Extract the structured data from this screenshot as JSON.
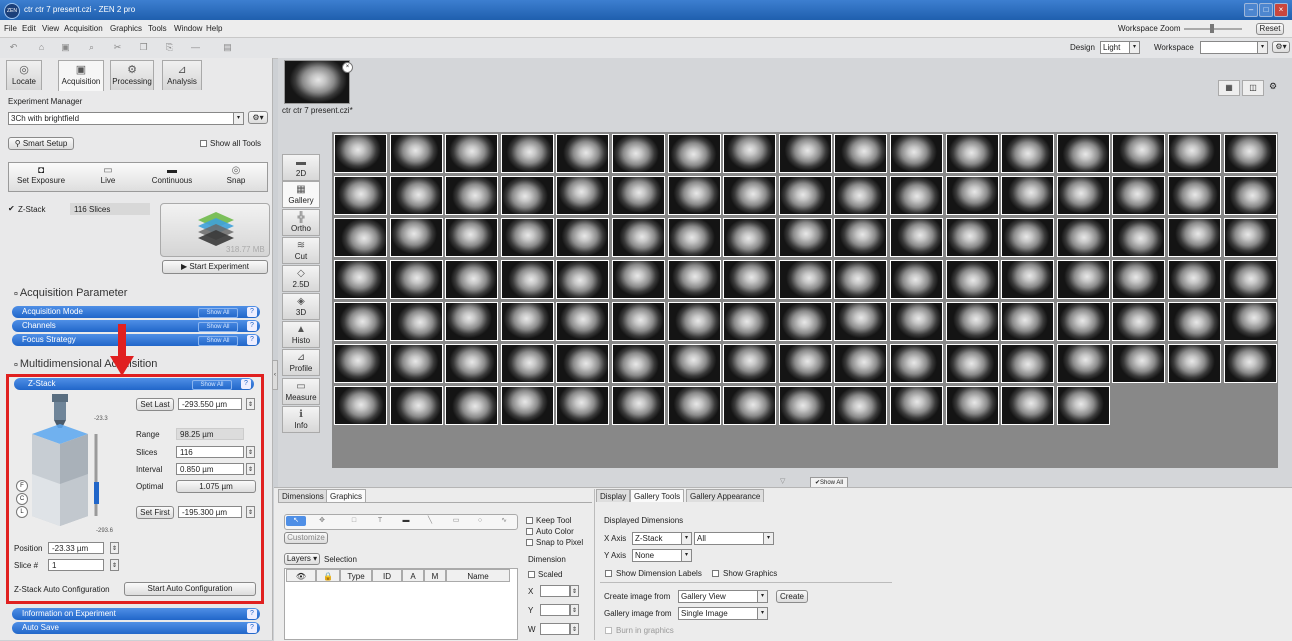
{
  "window": {
    "title": "ctr ctr 7 present.czi - ZEN 2 pro",
    "app_icon": "ZEN"
  },
  "menu": [
    "File",
    "Edit",
    "View",
    "Acquisition",
    "Graphics",
    "Tools",
    "Window",
    "Help"
  ],
  "top_right": {
    "workspace_zoom_label": "Workspace Zoom",
    "reset_label": "Reset",
    "design_label": "Design",
    "design_value": "Light",
    "workspace_label": "Workspace",
    "workspace_value": ""
  },
  "left_tabs": [
    {
      "label": "Locate",
      "icon": "locate-icon"
    },
    {
      "label": "Acquisition",
      "icon": "acquisition-icon"
    },
    {
      "label": "Processing",
      "icon": "processing-icon"
    },
    {
      "label": "Analysis",
      "icon": "analysis-icon"
    }
  ],
  "experiment": {
    "manager_label": "Experiment Manager",
    "name": "3Ch with brightfield",
    "smart_setup": "Smart Setup",
    "show_all_tools": "Show all Tools",
    "actions": [
      "Set Exposure",
      "Live",
      "Continuous",
      "Snap"
    ],
    "zstack_label": "Z-Stack",
    "zstack_slices": "116 Slices",
    "size": "318.77 MB",
    "start": "Start Experiment"
  },
  "acquisition_parameter": {
    "title": "Acquisition Parameter",
    "items": [
      "Acquisition Mode",
      "Channels",
      "Focus Strategy"
    ],
    "show_all": "Show All"
  },
  "multidimensional": {
    "title": "Multidimensional Acquisition",
    "zstack_bar": "Z-Stack",
    "show_all": "Show All",
    "set_last": "Set Last",
    "last_value": "-293.550 µm",
    "range_label": "Range",
    "range_value": "98.25 µm",
    "slices_label": "Slices",
    "slices_value": "116",
    "interval_label": "Interval",
    "interval_value": "0.850 µm",
    "optimal_label": "Optimal",
    "optimal_value": "1.075 µm",
    "set_first": "Set First",
    "first_value": "-195.300 µm",
    "scale_top": "-23.3",
    "scale_bottom": "-293.6",
    "side_letters": [
      "F",
      "C",
      "L"
    ],
    "position_label": "Position",
    "position_value": "-23.33 µm",
    "slice_label": "Slice #",
    "slice_value": "1",
    "auto_label": "Z-Stack Auto Configuration",
    "auto_button": "Start Auto Configuration"
  },
  "bottom_left_bars": [
    "Information on Experiment",
    "Auto Save"
  ],
  "document_tab": {
    "label": "ctr ctr 7 present.czi*"
  },
  "view_buttons": [
    {
      "label": "2D",
      "icon": "2d-view-icon"
    },
    {
      "label": "Gallery",
      "icon": "gallery-view-icon"
    },
    {
      "label": "Ortho",
      "icon": "ortho-view-icon"
    },
    {
      "label": "Cut",
      "icon": "cut-view-icon"
    },
    {
      "label": "2.5D",
      "icon": "25d-view-icon"
    },
    {
      "label": "3D",
      "icon": "3d-view-icon"
    },
    {
      "label": "Histo",
      "icon": "histo-view-icon"
    },
    {
      "label": "Profile",
      "icon": "profile-view-icon"
    },
    {
      "label": "Measure",
      "icon": "measure-view-icon"
    },
    {
      "label": "Info",
      "icon": "info-view-icon"
    }
  ],
  "gallery": {
    "total_tiles": 116,
    "show_all": "Show All"
  },
  "bottom_left_tabs": [
    "Dimensions",
    "Graphics"
  ],
  "graphics": {
    "customize": "Customize",
    "keep_tool": "Keep Tool",
    "auto_color": "Auto Color",
    "snap_to_pixel": "Snap to Pixel",
    "layers": "Layers",
    "selection": "Selection",
    "columns": [
      "Type",
      "ID",
      "A",
      "M",
      "Name"
    ],
    "dimension_label": "Dimension",
    "scaled": "Scaled",
    "fields": [
      "X",
      "Y",
      "W"
    ]
  },
  "bottom_right_tabs": [
    "Display",
    "Gallery Tools",
    "Gallery Appearance"
  ],
  "gallery_tools": {
    "displayed_dimensions": "Displayed Dimensions",
    "x_axis_label": "X Axis",
    "x_axis_value": "Z-Stack",
    "x_axis_sub": "All",
    "y_axis_label": "Y Axis",
    "y_axis_value": "None",
    "show_dim_labels": "Show Dimension Labels",
    "show_graphics": "Show Graphics",
    "create_from_label": "Create image from",
    "create_from_value": "Gallery View",
    "create_button": "Create",
    "gallery_from_label": "Gallery image from",
    "gallery_from_value": "Single Image",
    "burn_in": "Burn in graphics"
  },
  "colors": {
    "accent_blue": "#2166c9",
    "highlight_red": "#e02020"
  }
}
